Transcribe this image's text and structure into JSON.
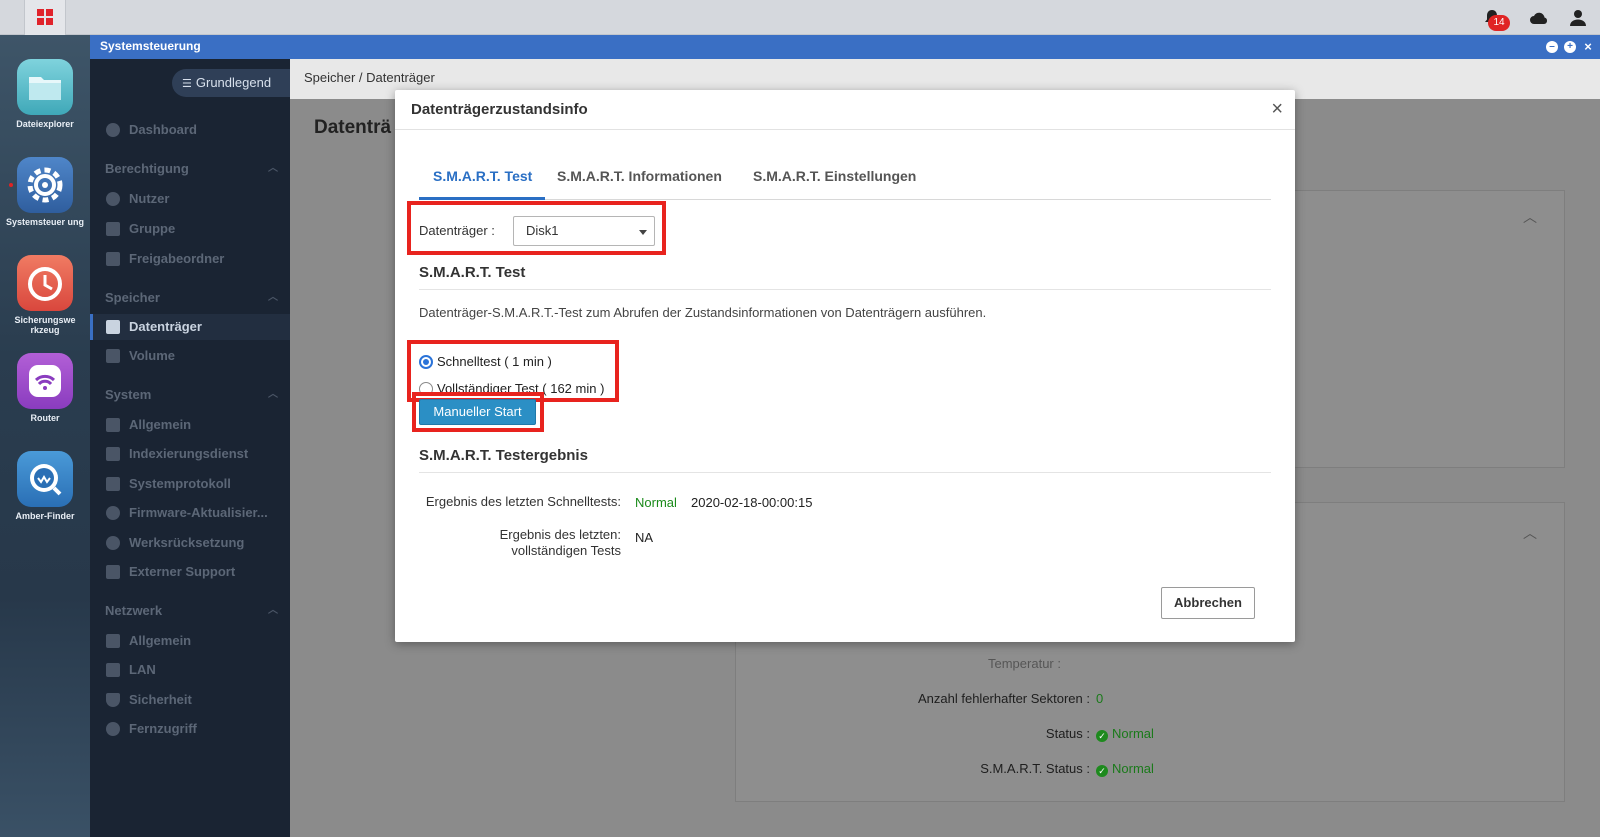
{
  "topbar": {
    "notification_count": "14"
  },
  "dock": {
    "items": [
      {
        "label": "Dateiexplorer",
        "icon": "folder-icon"
      },
      {
        "label": "Systemsteuer ung",
        "icon": "gear-icon"
      },
      {
        "label": "Sicherungswe rkzeug",
        "icon": "clock-backup-icon"
      },
      {
        "label": "Router",
        "icon": "wifi-icon"
      },
      {
        "label": "Amber-Finder",
        "icon": "finder-icon"
      }
    ]
  },
  "window": {
    "title": "Systemsteuerung"
  },
  "sidebar": {
    "mode_label": "Grundlegend",
    "dashboard": "Dashboard",
    "groups": [
      {
        "title": "Berechtigung",
        "items": [
          "Nutzer",
          "Gruppe",
          "Freigabeordner"
        ]
      },
      {
        "title": "Speicher",
        "items": [
          "Datenträger",
          "Volume"
        ]
      },
      {
        "title": "System",
        "items": [
          "Allgemein",
          "Indexierungsdienst",
          "Systemprotokoll",
          "Firmware-Aktualisier...",
          "Werksrücksetzung",
          "Externer Support"
        ]
      },
      {
        "title": "Netzwerk",
        "items": [
          "Allgemein",
          "LAN",
          "Sicherheit",
          "Fernzugriff"
        ]
      }
    ],
    "active_item": "Datenträger"
  },
  "content": {
    "breadcrumb": "Speicher / Datenträger",
    "page_title": "Datenträ",
    "bg_rows": [
      {
        "label": "Anzahl fehlerhafter Sektoren :",
        "value": "0",
        "check": false
      },
      {
        "label": "Status :",
        "value": "Normal",
        "check": true
      },
      {
        "label": "S.M.A.R.T. Status :",
        "value": "Normal",
        "check": true
      }
    ],
    "bg_partial": "Temperatur :"
  },
  "modal": {
    "title": "Datenträgerzustandsinfo",
    "close": "×",
    "tabs": [
      "S.M.A.R.T. Test",
      "S.M.A.R.T. Informationen",
      "S.M.A.R.T. Einstellungen"
    ],
    "active_tab": "S.M.A.R.T. Test",
    "disk_label": "Datenträger :",
    "disk_value": "Disk1",
    "test_section_title": "S.M.A.R.T. Test",
    "test_description": "Datenträger-S.M.A.R.T.-Test zum Abrufen der Zustandsinformationen von Datenträgern ausführen.",
    "options": [
      {
        "label": "Schnelltest ( 1 min )",
        "selected": true
      },
      {
        "label": "Vollständiger Test ( 162 min )",
        "selected": false
      }
    ],
    "start_button": "Manueller Start",
    "result_section_title": "S.M.A.R.T. Testergebnis",
    "results": {
      "quick_label": "Ergebnis des letzten Schnelltests:",
      "quick_status": "Normal",
      "quick_time": "2020-02-18-00:00:15",
      "full_label_line1": "Ergebnis des letzten:",
      "full_label_line2": "vollständigen Tests",
      "full_value": "NA"
    },
    "cancel_button": "Abbrechen"
  },
  "colors": {
    "accent": "#2a6fc4",
    "titlebar": "#3a6fc4",
    "highlight_box": "#e8231e",
    "status_ok": "#1a8a1a",
    "primary_button": "#2b8fc5"
  }
}
